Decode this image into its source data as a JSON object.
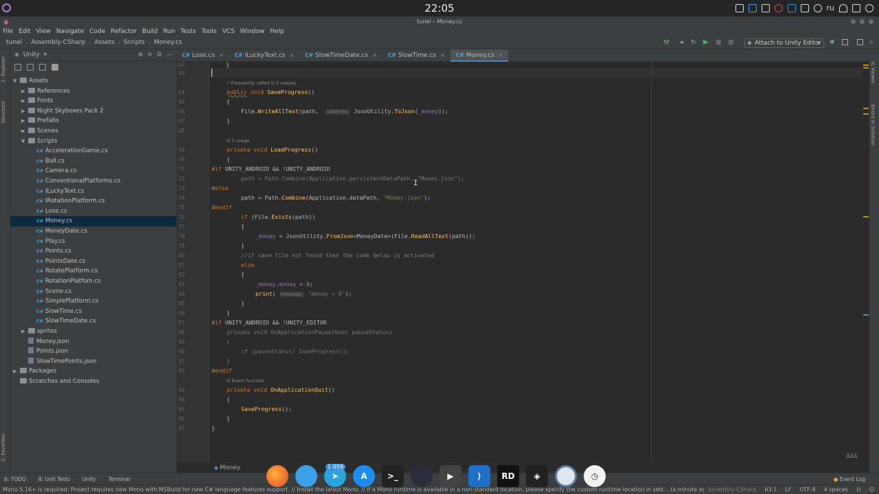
{
  "system": {
    "clock": "22:05",
    "lang": "ru"
  },
  "window_title": "tunel – Money.cs",
  "menu": [
    "File",
    "Edit",
    "View",
    "Navigate",
    "Code",
    "Refactor",
    "Build",
    "Run",
    "Tests",
    "Tools",
    "VCS",
    "Window",
    "Help"
  ],
  "navbar": {
    "crumbs": [
      "tunel",
      "Assembly-CSharp",
      "Assets",
      "Scripts",
      "Money.cs"
    ],
    "attach_label": "Attach to Unity Editor"
  },
  "side_tabs": {
    "explorer": "1: Explorer",
    "structure": "Structure",
    "favorites": "2: Favorites"
  },
  "right_tabs": {
    "il": "IL Viewer",
    "errors": "Errors In Solution"
  },
  "project": {
    "header": "Unity",
    "tree": [
      {
        "label": "Assets",
        "type": "folder",
        "depth": 0,
        "open": true
      },
      {
        "label": "References",
        "type": "ref",
        "depth": 1,
        "open": false
      },
      {
        "label": "Fonts",
        "type": "folder",
        "depth": 1,
        "open": false
      },
      {
        "label": "Night Skyboxes Pack 2",
        "type": "folder",
        "depth": 1,
        "open": false
      },
      {
        "label": "Prefabs",
        "type": "folder",
        "depth": 1,
        "open": false
      },
      {
        "label": "Scenes",
        "type": "folder",
        "depth": 1,
        "open": false
      },
      {
        "label": "Scripts",
        "type": "folder",
        "depth": 1,
        "open": true
      },
      {
        "label": "AccelerationGame.cs",
        "type": "cs",
        "depth": 2
      },
      {
        "label": "Ball.cs",
        "type": "cs",
        "depth": 2
      },
      {
        "label": "Camera.cs",
        "type": "cs",
        "depth": 2
      },
      {
        "label": "ConventionalPlatforms.cs",
        "type": "cs",
        "depth": 2
      },
      {
        "label": "ILuckyText.cs",
        "type": "cs",
        "depth": 2
      },
      {
        "label": "IRotationPlatform.cs",
        "type": "cs",
        "depth": 2
      },
      {
        "label": "Lose.cs",
        "type": "cs",
        "depth": 2
      },
      {
        "label": "Money.cs",
        "type": "cs",
        "depth": 2,
        "selected": true
      },
      {
        "label": "MoneyDate.cs",
        "type": "cs",
        "depth": 2
      },
      {
        "label": "Play.cs",
        "type": "cs",
        "depth": 2
      },
      {
        "label": "Points.cs",
        "type": "cs",
        "depth": 2
      },
      {
        "label": "PointsDate.cs",
        "type": "cs",
        "depth": 2
      },
      {
        "label": "RotatePlatform.cs",
        "type": "cs",
        "depth": 2
      },
      {
        "label": "RotationPlatfom.cs",
        "type": "cs",
        "depth": 2
      },
      {
        "label": "Scene.cs",
        "type": "cs",
        "depth": 2
      },
      {
        "label": "SimplePlatform.cs",
        "type": "cs",
        "depth": 2
      },
      {
        "label": "SlowTime.cs",
        "type": "cs",
        "depth": 2
      },
      {
        "label": "SlowTimeDate.cs",
        "type": "cs",
        "depth": 2
      },
      {
        "label": "sprites",
        "type": "folder",
        "depth": 1,
        "open": false
      },
      {
        "label": "Money.json",
        "type": "json",
        "depth": 1
      },
      {
        "label": "Points.json",
        "type": "json",
        "depth": 1
      },
      {
        "label": "SlowTimePoints.json",
        "type": "json",
        "depth": 1
      },
      {
        "label": "Packages",
        "type": "folder",
        "depth": 0,
        "open": false
      },
      {
        "label": "Scratches and Consoles",
        "type": "scratch",
        "depth": 0
      }
    ]
  },
  "tabs": [
    {
      "label": "Lose.cs",
      "active": false
    },
    {
      "label": "ILuckyText.cs",
      "active": false
    },
    {
      "label": "SlowTimeDate.cs",
      "active": false
    },
    {
      "label": "SlowTime.cs",
      "active": false
    },
    {
      "label": "Money.cs",
      "active": true
    }
  ],
  "code": {
    "hints": [
      "Frequently called",
      "2 usages",
      "1 usage",
      "Event function"
    ],
    "param_hints": {
      "contents": "contents:",
      "message": "message:"
    },
    "line_numbers": [
      "62",
      "63",
      "64",
      "65",
      "66",
      "67",
      "68",
      "69",
      "70",
      "71",
      "72",
      "73",
      "74",
      "75",
      "76",
      "77",
      "78",
      "79",
      "80",
      "81",
      "82",
      "83",
      "84",
      "85",
      "86",
      "87",
      "88",
      "89",
      "90",
      "91",
      "92",
      "93",
      "94",
      "95",
      "96",
      "97"
    ]
  },
  "editor_crumb": "Money",
  "toolstrip": [
    "6: TODO",
    "8: Unit Tests",
    "Unity",
    "Terminal"
  ],
  "event_log": "Event Log",
  "status": {
    "message": "Mono 5.16+ is required: Project requires new Mono with MSBuild for new C# language features support. // Install the latest Mono. // If a Mono runtime is available in a non-standard location, please specify the custom runtime location in sett... (a minute ago)",
    "context": "Assembly-CSharp",
    "position": "63:1",
    "line_sep": "LF",
    "encoding": "UTF-8",
    "indent": "4 spaces"
  },
  "dock": {
    "badge": "1 059",
    "rd": "RD"
  },
  "colors": {
    "accent": "#4a88c7",
    "selection": "#0d293e",
    "keyword": "#cc7832",
    "function": "#ffc66d",
    "string": "#6a8759",
    "number": "#6897bb"
  }
}
